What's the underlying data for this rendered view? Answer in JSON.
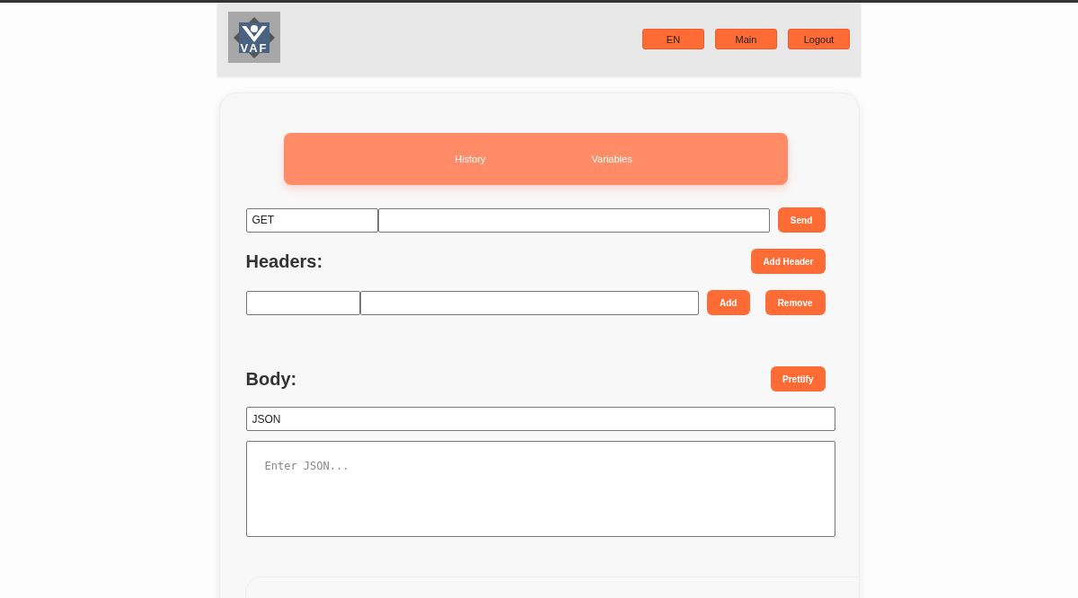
{
  "header": {
    "logo_text": "VAF",
    "buttons": [
      "EN",
      "Main",
      "Logout"
    ]
  },
  "nav": {
    "links": [
      "History",
      "Variables"
    ]
  },
  "request": {
    "method": "GET",
    "send": "Send"
  },
  "headers": {
    "title": "Headers:",
    "add_header": "Add Header",
    "row": {
      "add": "Add",
      "remove": "Remove"
    }
  },
  "body": {
    "title": "Body:",
    "prettify": "Prettify",
    "type": "JSON",
    "placeholder": "Enter JSON..."
  }
}
